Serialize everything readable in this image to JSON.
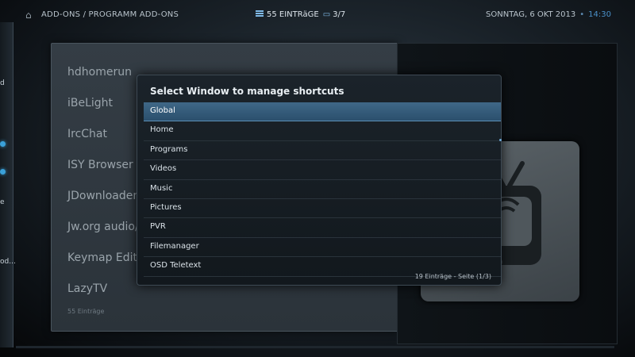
{
  "topbar": {
    "home_icon": "home-icon",
    "breadcrumb": "ADD-ONS / PROGRAMM ADD-ONS",
    "items_count": "55 EINTRäGE",
    "page": "3/7",
    "date": "SONNTAG, 6 OKT 2013",
    "separator": "•",
    "time": "14:30"
  },
  "left_panel": {
    "fragments": [
      "d",
      "e",
      "od..."
    ]
  },
  "addon_list": {
    "items": [
      "hdhomerun",
      "iBeLight",
      "IrcChat",
      "ISY Browser",
      "JDownloader",
      "Jw.org audio/",
      "Keymap Edito",
      "LazyTV"
    ],
    "count_label": "55 Einträge"
  },
  "dialog": {
    "title": "Select Window to manage shortcuts",
    "options": [
      "Global",
      "Home",
      "Programs",
      "Videos",
      "Music",
      "Pictures",
      "PVR",
      "Filemanager",
      "OSD Teletext"
    ],
    "focused_index": 0,
    "footer": "19 Einträge - Seite (1/3)"
  },
  "colors": {
    "accent": "#4a90c8",
    "focus": "#3f6887"
  }
}
